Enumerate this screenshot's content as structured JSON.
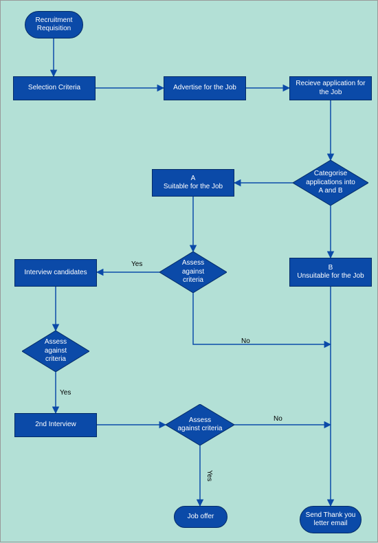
{
  "nodes": {
    "start": {
      "label": "Recruitment\nRequisition"
    },
    "criteria": {
      "label": "Selection Criteria"
    },
    "advertise": {
      "label": "Advertise for the Job"
    },
    "receive": {
      "label": "Recieve application for the Job"
    },
    "categorise": {
      "label": "Categorise applications into A and B"
    },
    "suitable": {
      "label": "A\nSuitable for the Job"
    },
    "unsuitable": {
      "label": "B\nUnsuitable for the Job"
    },
    "assess1": {
      "label": "Assess against criteria"
    },
    "interview1": {
      "label": "Interview candidates"
    },
    "assess2": {
      "label": "Assess against criteria"
    },
    "interview2": {
      "label": "2nd Interview"
    },
    "assess3": {
      "label": "Assess against criteria"
    },
    "joboffer": {
      "label": "Job offer"
    },
    "thankyou": {
      "label": "Send Thank you letter email"
    }
  },
  "edge_labels": {
    "assess1_yes": "Yes",
    "assess1_no": "No",
    "assess2_yes": "Yes",
    "assess3_yes": "Yes",
    "assess3_no": "No"
  },
  "colors": {
    "node_fill": "#0b4aa8",
    "node_text": "#ffffff",
    "background": "#b3e0d6"
  },
  "chart_data": {
    "type": "flowchart",
    "nodes": [
      {
        "id": "start",
        "shape": "terminator",
        "label": "Recruitment Requisition"
      },
      {
        "id": "criteria",
        "shape": "process",
        "label": "Selection Criteria"
      },
      {
        "id": "advertise",
        "shape": "process",
        "label": "Advertise for the Job"
      },
      {
        "id": "receive",
        "shape": "process",
        "label": "Recieve application for the Job"
      },
      {
        "id": "categorise",
        "shape": "decision",
        "label": "Categorise applications into A and B"
      },
      {
        "id": "suitable",
        "shape": "process",
        "label": "A – Suitable for the Job"
      },
      {
        "id": "unsuitable",
        "shape": "process",
        "label": "B – Unsuitable for the Job"
      },
      {
        "id": "assess1",
        "shape": "decision",
        "label": "Assess against criteria"
      },
      {
        "id": "interview1",
        "shape": "process",
        "label": "Interview candidates"
      },
      {
        "id": "assess2",
        "shape": "decision",
        "label": "Assess against criteria"
      },
      {
        "id": "interview2",
        "shape": "process",
        "label": "2nd Interview"
      },
      {
        "id": "assess3",
        "shape": "decision",
        "label": "Assess against criteria"
      },
      {
        "id": "joboffer",
        "shape": "terminator",
        "label": "Job offer"
      },
      {
        "id": "thankyou",
        "shape": "terminator",
        "label": "Send Thank you letter email"
      }
    ],
    "edges": [
      {
        "from": "start",
        "to": "criteria"
      },
      {
        "from": "criteria",
        "to": "advertise"
      },
      {
        "from": "advertise",
        "to": "receive"
      },
      {
        "from": "receive",
        "to": "categorise"
      },
      {
        "from": "categorise",
        "to": "suitable"
      },
      {
        "from": "categorise",
        "to": "unsuitable"
      },
      {
        "from": "suitable",
        "to": "assess1"
      },
      {
        "from": "assess1",
        "to": "interview1",
        "label": "Yes"
      },
      {
        "from": "assess1",
        "to": "thankyou",
        "label": "No"
      },
      {
        "from": "interview1",
        "to": "assess2"
      },
      {
        "from": "assess2",
        "to": "interview2",
        "label": "Yes"
      },
      {
        "from": "interview2",
        "to": "assess3"
      },
      {
        "from": "assess3",
        "to": "joboffer",
        "label": "Yes"
      },
      {
        "from": "assess3",
        "to": "thankyou",
        "label": "No"
      },
      {
        "from": "unsuitable",
        "to": "thankyou"
      }
    ]
  }
}
